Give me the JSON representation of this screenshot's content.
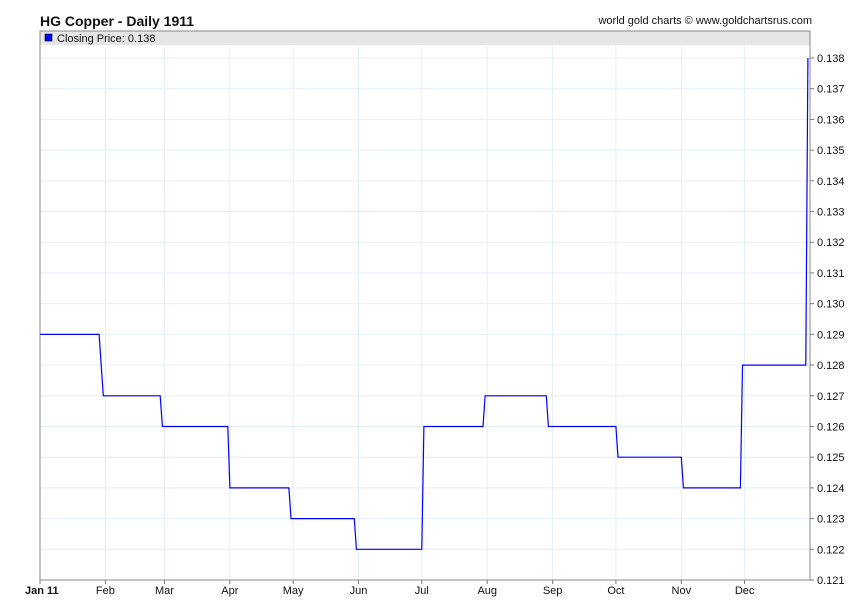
{
  "chart_data": {
    "type": "line",
    "title": "HG Copper - Daily 1911",
    "credit": "world gold charts © www.goldchartsrus.com",
    "legend": {
      "label": "Closing Price: 0.138",
      "color": "#0000ff",
      "placement": "top-left"
    },
    "xlabel": "",
    "ylabel": "",
    "x_ticks": [
      {
        "label": "Jan 11",
        "day": 0
      },
      {
        "label": "Feb",
        "day": 31
      },
      {
        "label": "Mar",
        "day": 59
      },
      {
        "label": "Apr",
        "day": 90
      },
      {
        "label": "May",
        "day": 120
      },
      {
        "label": "Jun",
        "day": 151
      },
      {
        "label": "Jul",
        "day": 181
      },
      {
        "label": "Aug",
        "day": 212
      },
      {
        "label": "Sep",
        "day": 243
      },
      {
        "label": "Oct",
        "day": 273
      },
      {
        "label": "Nov",
        "day": 304
      },
      {
        "label": "Dec",
        "day": 334
      }
    ],
    "xlim": [
      0,
      365
    ],
    "ylim": [
      0.121,
      0.1385
    ],
    "y_ticks": [
      "0.121",
      "0.122",
      "0.123",
      "0.124",
      "0.125",
      "0.126",
      "0.127",
      "0.128",
      "0.129",
      "0.130",
      "0.131",
      "0.132",
      "0.133",
      "0.134",
      "0.135",
      "0.136",
      "0.137",
      "0.138"
    ],
    "grid": true,
    "series": [
      {
        "name": "Closing Price",
        "color": "#0000ff",
        "points": [
          [
            0,
            0.129
          ],
          [
            28,
            0.129
          ],
          [
            30,
            0.127
          ],
          [
            57,
            0.127
          ],
          [
            58,
            0.126
          ],
          [
            89,
            0.126
          ],
          [
            90,
            0.124
          ],
          [
            118,
            0.124
          ],
          [
            119,
            0.123
          ],
          [
            149,
            0.123
          ],
          [
            150,
            0.122
          ],
          [
            181,
            0.122
          ],
          [
            182,
            0.126
          ],
          [
            210,
            0.126
          ],
          [
            211,
            0.127
          ],
          [
            240,
            0.127
          ],
          [
            241,
            0.126
          ],
          [
            273,
            0.126
          ],
          [
            274,
            0.125
          ],
          [
            304,
            0.125
          ],
          [
            305,
            0.124
          ],
          [
            332,
            0.124
          ],
          [
            333,
            0.128
          ],
          [
            363,
            0.128
          ],
          [
            364,
            0.138
          ]
        ]
      }
    ]
  }
}
